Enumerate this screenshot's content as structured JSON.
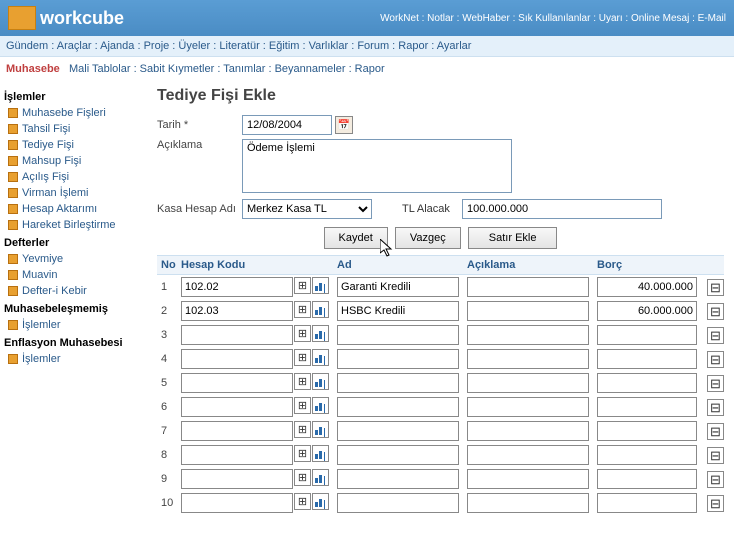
{
  "brand": "workcube",
  "top_links": "WorkNet : Notlar : WebHaber : Sık Kullanılanlar : Uyarı : Online Mesaj : E-Mail",
  "menu": "Gündem : Araçlar : Ajanda : Proje : Üyeler : Literatür : Eğitim : Varlıklar : Forum : Rapor : Ayarlar",
  "submenu": {
    "active": "Muhasebe",
    "rest": "Mali Tablolar : Sabit Kıymetler : Tanımlar : Beyannameler : Rapor"
  },
  "sidebar": {
    "section1_title": "İşlemler",
    "items1": [
      "Muhasebe Fişleri",
      "Tahsil Fişi",
      "Tediye Fişi",
      "Mahsup Fişi",
      "Açılış Fişi",
      "Virman İşlemi",
      "Hesap Aktarımı",
      "Hareket Birleştirme"
    ],
    "section2_title": "Defterler",
    "items2": [
      "Yevmiye",
      "Muavin",
      "Defter-i Kebir"
    ],
    "section3_title": "Muhasebeleşmemiş",
    "items3": [
      "İşlemler"
    ],
    "section4_title": "Enflasyon Muhasebesi",
    "items4": [
      "İşlemler"
    ]
  },
  "page_title": "Tediye Fişi Ekle",
  "form": {
    "tarih_label": "Tarih *",
    "tarih_value": "12/08/2004",
    "aciklama_label": "Açıklama",
    "aciklama_value": "Ödeme İşlemi",
    "kasa_label": "Kasa Hesap Adı",
    "kasa_value": "Merkez Kasa TL",
    "tl_label": "TL Alacak",
    "tl_value": "100.000.000"
  },
  "buttons": {
    "save": "Kaydet",
    "cancel": "Vazgeç",
    "addrow": "Satır Ekle"
  },
  "grid": {
    "headers": {
      "no": "No",
      "hk": "Hesap Kodu",
      "ad": "Ad",
      "ack": "Açıklama",
      "borc": "Borç"
    },
    "rows": [
      {
        "no": "1",
        "hk": "102.02",
        "ad": "Garanti Kredili",
        "ack": "",
        "borc": "40.000.000"
      },
      {
        "no": "2",
        "hk": "102.03",
        "ad": "HSBC Kredili",
        "ack": "",
        "borc": "60.000.000"
      },
      {
        "no": "3",
        "hk": "",
        "ad": "",
        "ack": "",
        "borc": ""
      },
      {
        "no": "4",
        "hk": "",
        "ad": "",
        "ack": "",
        "borc": ""
      },
      {
        "no": "5",
        "hk": "",
        "ad": "",
        "ack": "",
        "borc": ""
      },
      {
        "no": "6",
        "hk": "",
        "ad": "",
        "ack": "",
        "borc": ""
      },
      {
        "no": "7",
        "hk": "",
        "ad": "",
        "ack": "",
        "borc": ""
      },
      {
        "no": "8",
        "hk": "",
        "ad": "",
        "ack": "",
        "borc": ""
      },
      {
        "no": "9",
        "hk": "",
        "ad": "",
        "ack": "",
        "borc": ""
      },
      {
        "no": "10",
        "hk": "",
        "ad": "",
        "ack": "",
        "borc": ""
      }
    ]
  }
}
